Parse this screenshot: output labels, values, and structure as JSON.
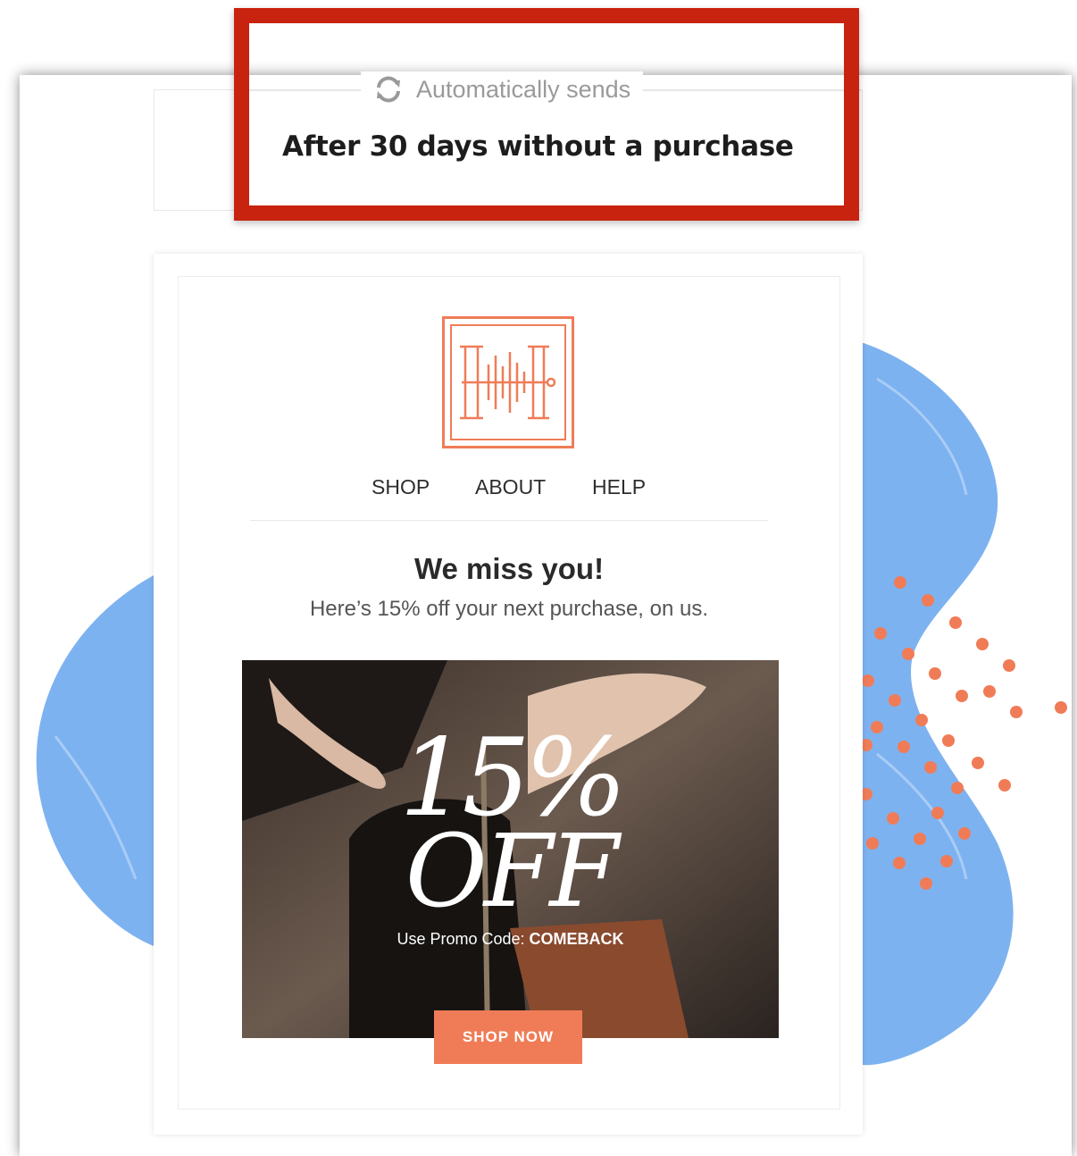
{
  "trigger": {
    "label": "Automatically sends",
    "icon": "refresh-icon",
    "condition": "After 30 days without a purchase"
  },
  "email": {
    "logo_icon": "brand-logo",
    "nav": {
      "shop": "SHOP",
      "about": "ABOUT",
      "help": "HELP"
    },
    "headline": "We miss you!",
    "subline": "Here’s 15% off your next purchase, on us.",
    "hero": {
      "big_percent": "15%",
      "big_off": "OFF",
      "promo_prefix": "Use Promo Code:",
      "promo_code": "COMEBACK"
    },
    "cta_label": "SHOP NOW"
  },
  "colors": {
    "highlight": "#c8230f",
    "accent": "#f07c57",
    "blob": "#7db2f0"
  }
}
